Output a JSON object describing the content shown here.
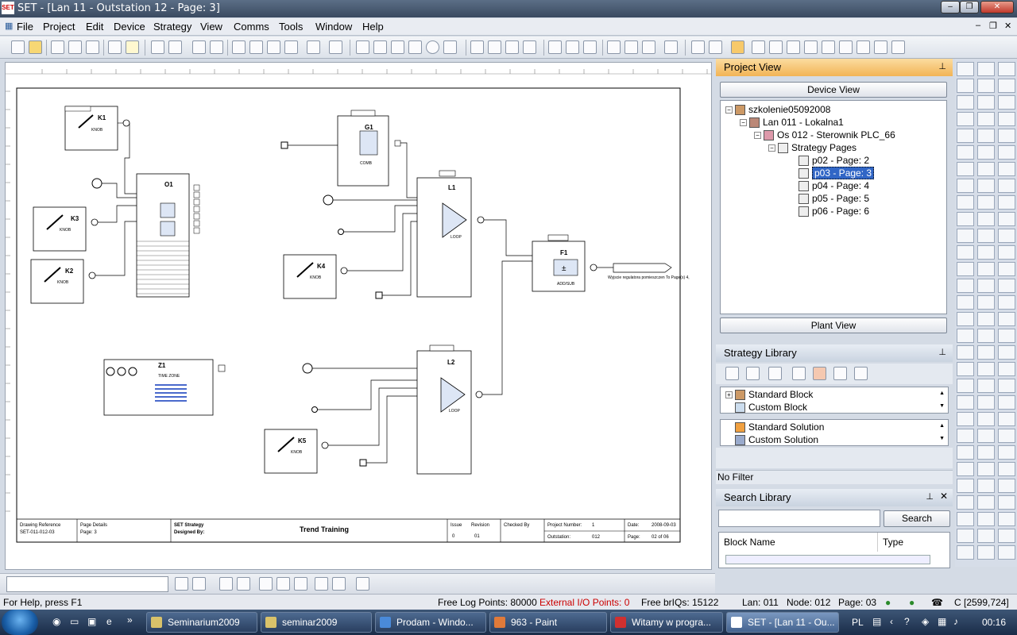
{
  "window": {
    "title": "SET - [Lan 11 - Outstation 12 - Page: 3]",
    "logo": "SET"
  },
  "menu": [
    "File",
    "Project",
    "Edit",
    "Device",
    "Strategy",
    "View",
    "Comms",
    "Tools",
    "Window",
    "Help"
  ],
  "drawing": {
    "blocks": {
      "K1": "K1",
      "K2": "K2",
      "K3": "K3",
      "K4": "K4",
      "K5": "K5",
      "O1": "O1",
      "G1": "G1",
      "L1": "L1",
      "L2": "L2",
      "F1": "F1",
      "Z1": "Z1"
    },
    "knob": "KNOB",
    "loop": "LOOP",
    "comb": "COMB",
    "addsub": "ADD/SUB",
    "timezone": "TIME ZONE",
    "titleblock": {
      "drawing_ref_label": "Drawing Reference",
      "drawing_ref": "SET-011-012-03",
      "page_details_label": "Page Details",
      "page": "Page: 3",
      "strategy_label": "SET Strategy",
      "designed_by": "Designed By:",
      "title": "Trend Training",
      "issue_label": "Issue",
      "revision_label": "Revision",
      "issue": "0",
      "revision": "01",
      "checked_label": "Checked By",
      "project_number_label": "Project Number:",
      "project_number": "1",
      "outstation_label": "Outstation:",
      "outstation": "012",
      "date_label": "Date:",
      "date": "2008-09-03",
      "page_label": "Page:",
      "page_of": "02  of  06"
    },
    "output_label": "Wyjscie regulatora pomieszczen To Page(s) 4,"
  },
  "project_view": {
    "title": "Project View",
    "device_view": "Device View",
    "plant_view": "Plant View",
    "tree": [
      "szkolenie05092008",
      "Lan 011 - Lokalna1",
      "Os 012 - Sterownik  PLC_66",
      "Strategy Pages",
      "p02 - Page: 2",
      "p03 - Page: 3",
      "p04 - Page: 4",
      "p05 - Page: 5",
      "p06 - Page: 6"
    ],
    "selected": "p03 - Page: 3"
  },
  "strategy_library": {
    "title": "Strategy Library",
    "blocks": [
      "Standard Block",
      "Custom Block"
    ],
    "solutions": [
      "Standard Solution",
      "Custom Solution"
    ],
    "filter": "No Filter"
  },
  "search_library": {
    "title": "Search Library",
    "search_button": "Search",
    "search_value": "",
    "columns": [
      "Block Name",
      "Type"
    ]
  },
  "status": {
    "help": "For Help, press F1",
    "log_points": "Free Log Points: 80000",
    "io_points": "External I/O Points: 0",
    "briqs": "Free brIQs: 15122",
    "lan": "Lan: 011",
    "node": "Node: 012",
    "page": "Page: 03",
    "coords": "C [2599,724]"
  },
  "taskbar": {
    "items": [
      "Seminarium2009",
      "seminar2009",
      "Prodam - Windo...",
      "963 - Paint",
      "Witamy w progra...",
      "SET - [Lan 11 - Ou..."
    ],
    "lang": "PL",
    "clock": "00:16"
  },
  "colors": {
    "selection": "#3166c6",
    "panel_header": "#f5c060",
    "status_error": "#cc0000"
  }
}
